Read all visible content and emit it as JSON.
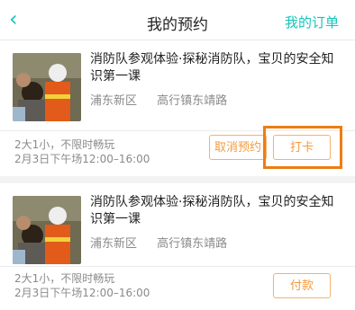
{
  "header": {
    "title": "我的预约",
    "right_link": "我的订单"
  },
  "bookings": [
    {
      "title": "消防队参观体验·探秘消防队，宝贝的安全知识第一课",
      "district": "浦东新区",
      "address": "高行镇东靖路",
      "meta_line1": "2大1小，不限时畅玩",
      "meta_line2": "2月3日下午场12:00–16:00",
      "cancel_label": "取消预约",
      "checkin_label": "打卡"
    },
    {
      "title": "消防队参观体验·探秘消防队，宝贝的安全知识第一课",
      "district": "浦东新区",
      "address": "高行镇东靖路",
      "meta_line1": "2大1小，不限时畅玩",
      "meta_line2": "2月3日下午场12:00–16:00",
      "pay_label": "付款"
    }
  ],
  "colors": {
    "accent": "#17c4bb",
    "orange": "#f39b3e",
    "highlight": "#ee7d12"
  }
}
